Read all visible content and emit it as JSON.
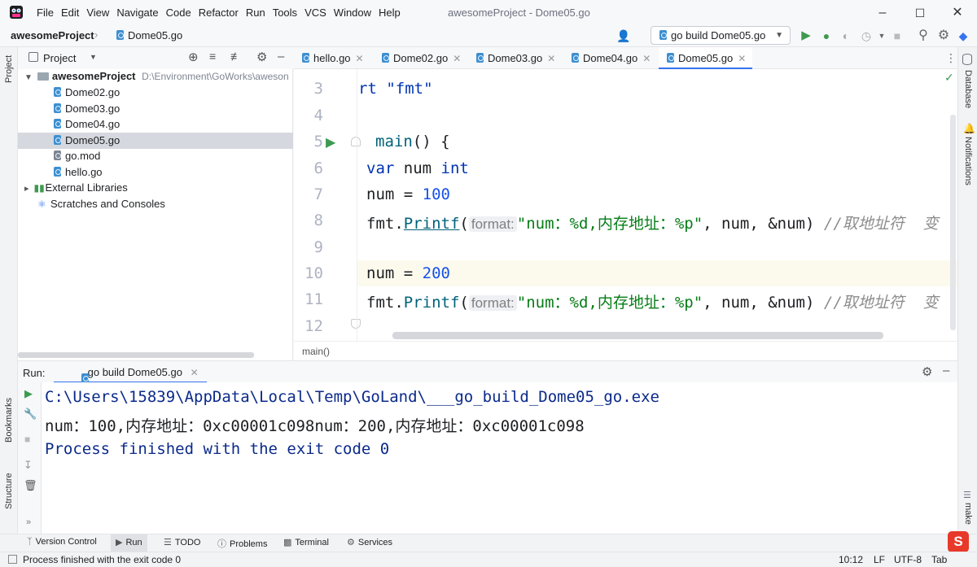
{
  "app": {
    "window_title": "awesomeProject - Dome05.go",
    "menu": [
      "File",
      "Edit",
      "View",
      "Navigate",
      "Code",
      "Refactor",
      "Run",
      "Tools",
      "VCS",
      "Window",
      "Help"
    ]
  },
  "nav": {
    "project": "awesomeProject",
    "file": "Dome05.go",
    "run_config": "go build Dome05.go"
  },
  "project_panel": {
    "title": "Project",
    "root_name": "awesomeProject",
    "root_path": "D:\\Environment\\GoWorks\\aweson",
    "files": [
      "Dome02.go",
      "Dome03.go",
      "Dome04.go",
      "Dome05.go",
      "go.mod",
      "hello.go"
    ],
    "external": "External Libraries",
    "scratches": "Scratches and Consoles"
  },
  "editor": {
    "tabs": [
      "hello.go",
      "Dome02.go",
      "Dome03.go",
      "Dome04.go",
      "Dome05.go"
    ],
    "line_numbers": [
      "3",
      "4",
      "5",
      "6",
      "7",
      "8",
      "9",
      "10",
      "11",
      "12"
    ],
    "hint": "format:",
    "breadcrumb": "main()"
  },
  "code": {
    "l3": "rt \"fmt\"",
    "l5_kw": "main",
    "l5_rest": "() {",
    "l6_kw": "var",
    "l6_mid": " num ",
    "l6_type": "int",
    "l7_a": "num = ",
    "l7_n": "100",
    "l8_fn": "fmt.",
    "l8_call": "Printf",
    "l8_open": "(",
    "l8_str": "\"num：%d,内存地址：%p\"",
    "l8_args": ", num, &num) ",
    "l8_cmt": "//取地址符  变",
    "l10_a": "num = ",
    "l10_n": "200",
    "l11_fn": "fmt.",
    "l11_call": "Printf",
    "l11_open": "(",
    "l11_str": "\"num：%d,内存地址：%p\"",
    "l11_args": ", num, &num) ",
    "l11_cmt": "//取地址符  变"
  },
  "run": {
    "label": "Run:",
    "tab": "go build Dome05.go",
    "lines": [
      "C:\\Users\\15839\\AppData\\Local\\Temp\\GoLand\\___go_build_Dome05_go.exe",
      "num：100,内存地址：0xc00001c098num：200,内存地址：0xc00001c098",
      "Process finished with the exit code 0"
    ]
  },
  "side": {
    "left": [
      "Project",
      "Bookmarks",
      "Structure"
    ],
    "right": [
      "Database",
      "Notifications",
      "make"
    ]
  },
  "bottom_tools": [
    "Version Control",
    "Run",
    "TODO",
    "Problems",
    "Terminal",
    "Services"
  ],
  "status": {
    "message": "Process finished with the exit code 0",
    "position": "10:12",
    "line_sep": "LF",
    "encoding": "UTF-8",
    "indent": "Tab"
  },
  "colors": {
    "accent": "#3574f0",
    "run_green": "#3d9a50",
    "console_blue": "#0b2a8a"
  }
}
